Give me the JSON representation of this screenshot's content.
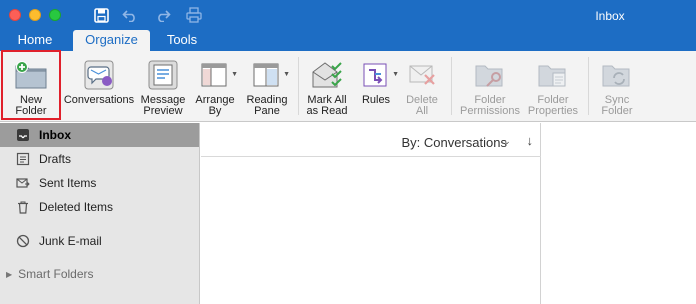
{
  "window": {
    "title": "Inbox"
  },
  "tabs": [
    {
      "label": "Home"
    },
    {
      "label": "Organize"
    },
    {
      "label": "Tools"
    }
  ],
  "ribbon": {
    "new_folder": "New\nFolder",
    "conversations": "Conversations",
    "message_preview": "Message\nPreview",
    "arrange_by": "Arrange\nBy",
    "reading_pane": "Reading\nPane",
    "mark_all_as_read": "Mark All\nas Read",
    "rules": "Rules",
    "delete_all": "Delete\nAll",
    "folder_permissions": "Folder\nPermissions",
    "folder_properties": "Folder\nProperties",
    "sync_folder": "Sync\nFolder"
  },
  "sidebar": {
    "folders": [
      {
        "label": "Inbox",
        "icon": "inbox-icon"
      },
      {
        "label": "Drafts",
        "icon": "drafts-icon"
      },
      {
        "label": "Sent Items",
        "icon": "sent-icon"
      },
      {
        "label": "Deleted Items",
        "icon": "trash-icon"
      },
      {
        "label": "Junk E-mail",
        "icon": "junk-icon"
      }
    ],
    "smart_folders": "Smart Folders"
  },
  "message_list": {
    "sort_label": "By: Conversations",
    "sort_chevron": "⌄",
    "sort_direction": "↓"
  },
  "colors": {
    "accent": "#1d6dc4",
    "highlight_border": "#e0202b"
  }
}
